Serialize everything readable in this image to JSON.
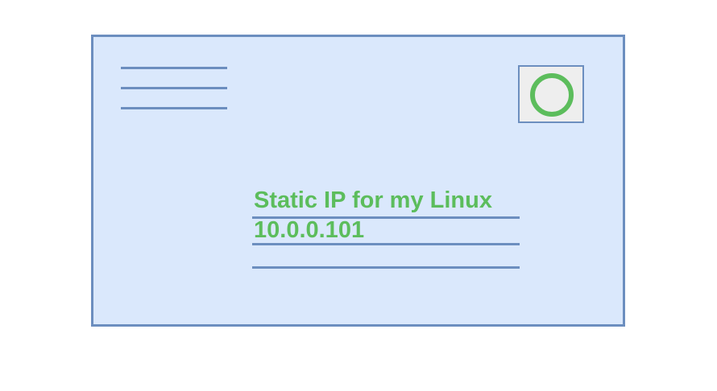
{
  "envelope": {
    "address_line_1": "Static IP for my Linux",
    "address_line_2": "10.0.0.101",
    "address_line_3": ""
  },
  "colors": {
    "envelope_fill": "#dae8fc",
    "envelope_stroke": "#6c8ebf",
    "text": "#5cbd5c",
    "stamp_fill": "#eeeeee",
    "stamp_ring": "#5cbd5c"
  },
  "icons": {
    "stamp": "circle-stamp-icon"
  }
}
